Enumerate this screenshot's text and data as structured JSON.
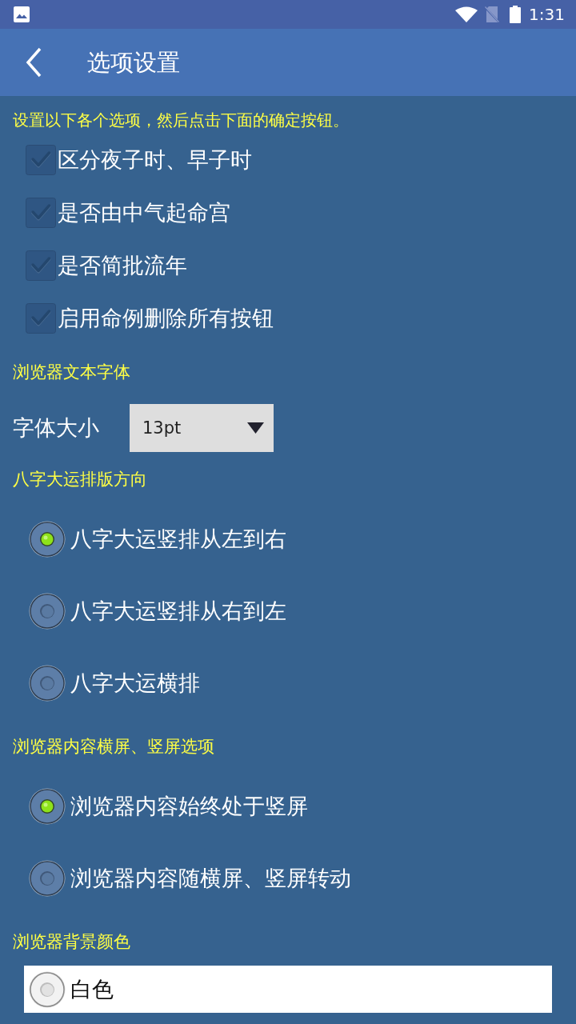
{
  "status_bar": {
    "time": "1:31"
  },
  "app_bar": {
    "title": "选项设置"
  },
  "sections": [
    {
      "kind": "checks",
      "heading": "设置以下各个选项，然后点击下面的确定按钮。",
      "items": [
        {
          "label": "区分夜子时、早子时",
          "checked": true
        },
        {
          "label": "是否由中气起命宫",
          "checked": true
        },
        {
          "label": "是否简批流年",
          "checked": true
        },
        {
          "label": "启用命例删除所有按钮",
          "checked": true
        }
      ]
    },
    {
      "kind": "dropdown",
      "heading": "浏览器文本字体",
      "label": "字体大小",
      "value": "13pt"
    },
    {
      "kind": "radios",
      "heading": "八字大运排版方向",
      "options": [
        {
          "label": "八字大运竖排从左到右",
          "selected": true
        },
        {
          "label": "八字大运竖排从右到左",
          "selected": false
        },
        {
          "label": "八字大运横排",
          "selected": false
        }
      ]
    },
    {
      "kind": "radios",
      "heading": "浏览器内容横屏、竖屏选项",
      "options": [
        {
          "label": "浏览器内容始终处于竖屏",
          "selected": true
        },
        {
          "label": "浏览器内容随横屏、竖屏转动",
          "selected": false
        }
      ]
    },
    {
      "kind": "radios",
      "heading": "浏览器背景颜色",
      "options": [
        {
          "label": "白色",
          "selected": false,
          "color": "#ffffff"
        }
      ]
    }
  ]
}
